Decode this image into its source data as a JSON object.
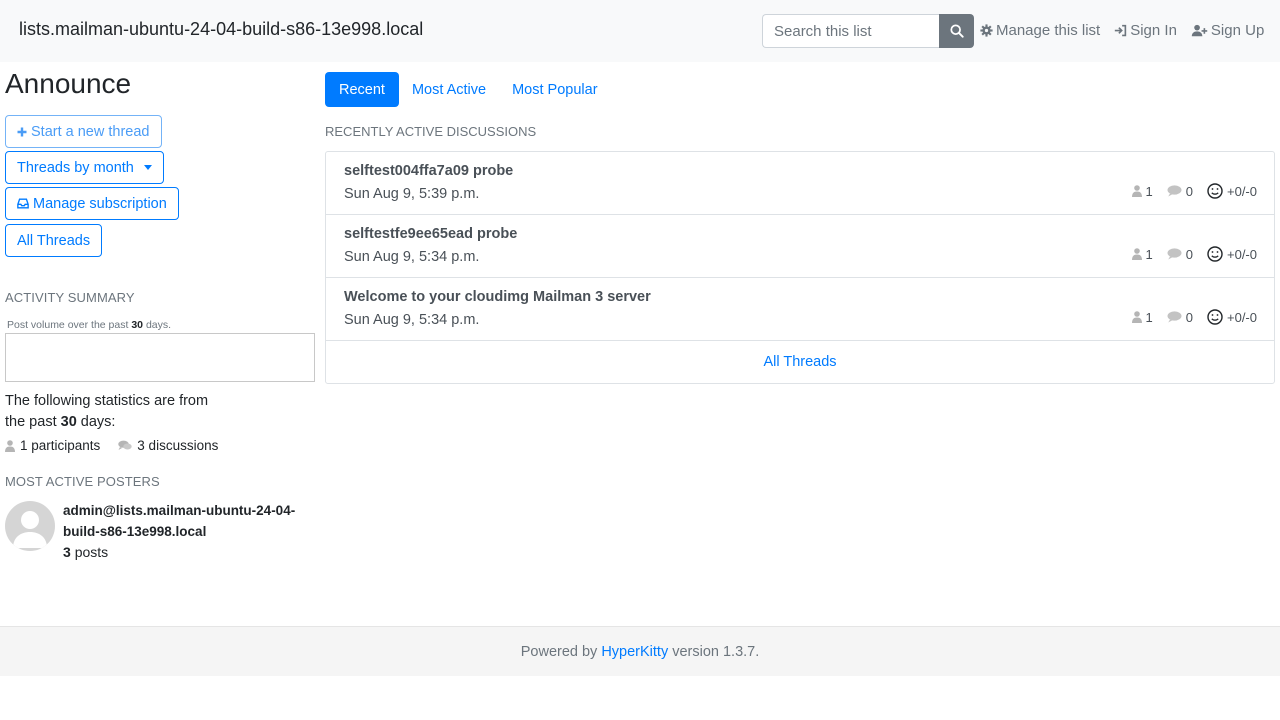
{
  "header": {
    "brand": "lists.mailman-ubuntu-24-04-build-s86-13e998.local",
    "search_placeholder": "Search this list",
    "manage_list": "Manage this list",
    "sign_in": "Sign In",
    "sign_up": "Sign Up"
  },
  "sidebar": {
    "title": "Announce",
    "start_thread": "Start a new thread",
    "threads_by_month": "Threads by month",
    "manage_subscription": "Manage subscription",
    "all_threads": "All Threads",
    "activity_label": "ACTIVITY SUMMARY",
    "note_prefix": "Post volume over the past",
    "note_days": "30",
    "note_suffix": "days.",
    "stats_line1": "The following statistics are from",
    "stats_line2_prefix": "the past",
    "stats_days": "30",
    "stats_line2_suffix": "days:",
    "participants": "1 participants",
    "discussions": "3 discussions",
    "posters_label": "MOST ACTIVE POSTERS",
    "poster_name": "admin@lists.mailman-ubuntu-24-04-build-s86-13e998.local",
    "poster_count": "3",
    "poster_posts_word": "posts"
  },
  "tabs": [
    {
      "label": "Recent"
    },
    {
      "label": "Most Active"
    },
    {
      "label": "Most Popular"
    }
  ],
  "discussions_label": "RECENTLY ACTIVE DISCUSSIONS",
  "threads": [
    {
      "subject": "selftest004ffa7a09 probe",
      "date": "Sun Aug 9, 5:39 p.m.",
      "participants": "1",
      "replies": "0",
      "votes": "+0/-0"
    },
    {
      "subject": "selftestfe9ee65ead probe",
      "date": "Sun Aug 9, 5:34 p.m.",
      "participants": "1",
      "replies": "0",
      "votes": "+0/-0"
    },
    {
      "subject": "Welcome to your cloudimg Mailman 3 server",
      "date": "Sun Aug 9, 5:34 p.m.",
      "participants": "1",
      "replies": "0",
      "votes": "+0/-0"
    }
  ],
  "all_threads_link": "All Threads",
  "footer": {
    "prefix": "Powered by",
    "link": "HyperKitty",
    "suffix": "version 1.3.7."
  },
  "colors": {
    "primary": "#007bff",
    "muted": "#6c757d",
    "navbar_bg": "#f8f9fa"
  },
  "icons": [
    "search-icon",
    "gear-icon",
    "sign-in-icon",
    "user-plus-icon",
    "plus-icon",
    "inbox-icon",
    "user-icon",
    "comment-icon",
    "smile-icon"
  ]
}
